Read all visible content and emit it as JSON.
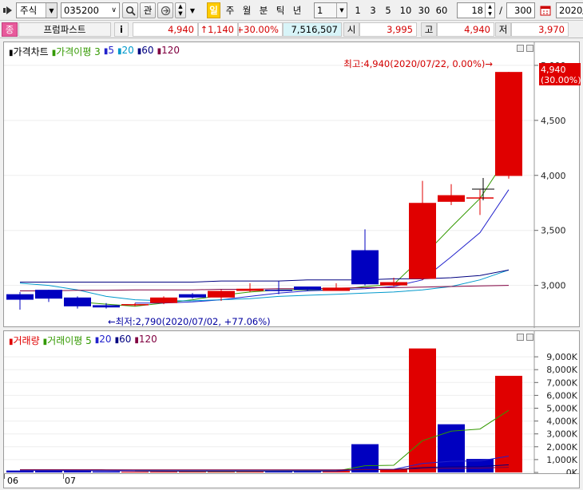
{
  "toolbar": {
    "market": "주식",
    "code": "035200",
    "watch_label": "관",
    "period_labels": [
      "일",
      "주",
      "월",
      "분",
      "틱",
      "년"
    ],
    "interval_value": "1",
    "interval_options": [
      "1",
      "3",
      "5",
      "10",
      "30",
      "60"
    ],
    "count_value": "18",
    "count_sep": "/",
    "count_max": "300",
    "date_value": "2020/"
  },
  "info": {
    "stock_name_tag": "종",
    "stock_name": "프럼파스트",
    "info_btn": "i",
    "price": "4,940",
    "change": "↑1,140",
    "change_rate": "+30.00%",
    "volume": "7,516,507",
    "open_label": "시",
    "open": "3,995",
    "high_label": "고",
    "high": "4,940",
    "low_label": "저",
    "low": "3,970"
  },
  "colors": {
    "up": "#e00000",
    "down": "#0000c0",
    "ma3": "#339900",
    "ma5": "#2222cc",
    "ma20": "#0099cc",
    "ma60": "#000080",
    "ma120": "#800040"
  },
  "price_panel": {
    "legend": [
      {
        "text": "가격차트",
        "color": "#000000"
      },
      {
        "text": "가격이평 3",
        "color": "#339900"
      },
      {
        "text": "5",
        "color": "#2222cc"
      },
      {
        "text": "20",
        "color": "#0099cc"
      },
      {
        "text": "60",
        "color": "#000080"
      },
      {
        "text": "120",
        "color": "#800040"
      }
    ],
    "max_annotation": "최고:4,940(2020/07/22, 0.00%)→",
    "min_annotation": "←최저:2,790(2020/07/02, +77.06%)",
    "last_price_badge": "4,940",
    "last_rate_badge": "(30.00%)"
  },
  "volume_panel": {
    "legend": [
      {
        "text": "거래량",
        "color": "#e00000"
      },
      {
        "text": "거래이평 5",
        "color": "#339900"
      },
      {
        "text": "20",
        "color": "#2222cc"
      },
      {
        "text": "60",
        "color": "#000080"
      },
      {
        "text": "120",
        "color": "#800040"
      }
    ]
  },
  "x_axis": {
    "labels": [
      "06",
      "07"
    ]
  },
  "chart_data": [
    {
      "type": "candlestick",
      "title": "가격차트",
      "ylim": [
        2700,
        5050
      ],
      "yticks": [
        3000,
        3500,
        4000,
        4500,
        5000
      ],
      "ytick_labels": [
        "3,000",
        "3,500",
        "4,000",
        "4,500",
        "5,000"
      ],
      "candles": [
        {
          "open": 2920,
          "high": 2940,
          "low": 2780,
          "close": 2870
        },
        {
          "open": 2960,
          "high": 2960,
          "low": 2850,
          "close": 2880
        },
        {
          "open": 2890,
          "high": 2900,
          "low": 2790,
          "close": 2810
        },
        {
          "open": 2820,
          "high": 2840,
          "low": 2790,
          "close": 2800
        },
        {
          "open": 2820,
          "high": 2840,
          "low": 2810,
          "close": 2830
        },
        {
          "open": 2840,
          "high": 2900,
          "low": 2830,
          "close": 2890
        },
        {
          "open": 2920,
          "high": 2930,
          "low": 2880,
          "close": 2890
        },
        {
          "open": 2890,
          "high": 2960,
          "low": 2860,
          "close": 2950
        },
        {
          "open": 2950,
          "high": 3020,
          "low": 2940,
          "close": 2970
        },
        {
          "open": 2960,
          "high": 3040,
          "low": 2920,
          "close": 2950
        },
        {
          "open": 2990,
          "high": 2990,
          "low": 2950,
          "close": 2960
        },
        {
          "open": 2950,
          "high": 3020,
          "low": 2950,
          "close": 2980
        },
        {
          "open": 3320,
          "high": 3510,
          "low": 3000,
          "close": 3010
        },
        {
          "open": 3000,
          "high": 3070,
          "low": 2990,
          "close": 3030
        },
        {
          "open": 3060,
          "high": 3950,
          "low": 3050,
          "close": 3750
        },
        {
          "open": 3760,
          "high": 3920,
          "low": 3730,
          "close": 3820
        },
        {
          "open": 3800,
          "high": 3870,
          "low": 3640,
          "close": 3800
        },
        {
          "open": 3995,
          "high": 4940,
          "low": 3970,
          "close": 4940
        }
      ],
      "series": [
        {
          "name": "3",
          "values": [
            null,
            null,
            2850,
            2830,
            2810,
            2840,
            2870,
            2910,
            2940,
            2960,
            2960,
            2960,
            2990,
            3010,
            3260,
            3530,
            3790,
            4190
          ]
        },
        {
          "name": "5",
          "values": [
            null,
            null,
            null,
            null,
            2840,
            2840,
            2850,
            2870,
            2900,
            2930,
            2950,
            2960,
            2970,
            2990,
            3050,
            3260,
            3480,
            3870
          ]
        },
        {
          "name": "20",
          "values": [
            3020,
            3000,
            2960,
            2900,
            2870,
            2860,
            2860,
            2870,
            2880,
            2900,
            2910,
            2920,
            2930,
            2940,
            2960,
            2990,
            3050,
            3140
          ]
        },
        {
          "name": "60",
          "values": [
            3030,
            3030,
            3030,
            3030,
            3030,
            3030,
            3030,
            3040,
            3040,
            3040,
            3050,
            3050,
            3050,
            3060,
            3060,
            3070,
            3090,
            3140
          ]
        },
        {
          "name": "120",
          "values": [
            2950,
            2950,
            2955,
            2955,
            2960,
            2960,
            2960,
            2965,
            2965,
            2970,
            2970,
            2975,
            2980,
            2980,
            2985,
            2990,
            2995,
            3000
          ]
        }
      ]
    },
    {
      "type": "bar",
      "title": "거래량",
      "ylim": [
        0,
        10000
      ],
      "yticks": [
        0,
        1000,
        2000,
        3000,
        4000,
        5000,
        6000,
        7000,
        8000,
        9000
      ],
      "ytick_labels": [
        "0K",
        "1,000K",
        "2,000K",
        "3,000K",
        "4,000K",
        "5,000K",
        "6,000K",
        "7,000K",
        "8,000K",
        "9,000K"
      ],
      "values": [
        150,
        160,
        140,
        80,
        60,
        70,
        90,
        100,
        110,
        100,
        120,
        130,
        2200,
        250,
        9650,
        3750,
        1050,
        7520
      ],
      "up": [
        false,
        false,
        false,
        false,
        true,
        true,
        true,
        true,
        true,
        false,
        false,
        true,
        false,
        true,
        true,
        false,
        false,
        true
      ],
      "series": [
        {
          "name": "5",
          "values": [
            null,
            null,
            null,
            null,
            120,
            100,
            90,
            80,
            90,
            100,
            110,
            110,
            520,
            560,
            2470,
            3210,
            3380,
            4840
          ]
        },
        {
          "name": "20",
          "values": [
            150,
            150,
            140,
            130,
            120,
            110,
            110,
            110,
            110,
            110,
            110,
            110,
            230,
            240,
            700,
            870,
            900,
            1270
          ]
        },
        {
          "name": "60",
          "values": [
            200,
            200,
            195,
            190,
            185,
            180,
            180,
            180,
            180,
            180,
            180,
            180,
            220,
            230,
            380,
            440,
            460,
            590
          ]
        },
        {
          "name": "120",
          "values": [
            210,
            210,
            210,
            205,
            205,
            205,
            205,
            205,
            205,
            205,
            205,
            205,
            225,
            225,
            300,
            330,
            340,
            400
          ]
        }
      ]
    }
  ]
}
